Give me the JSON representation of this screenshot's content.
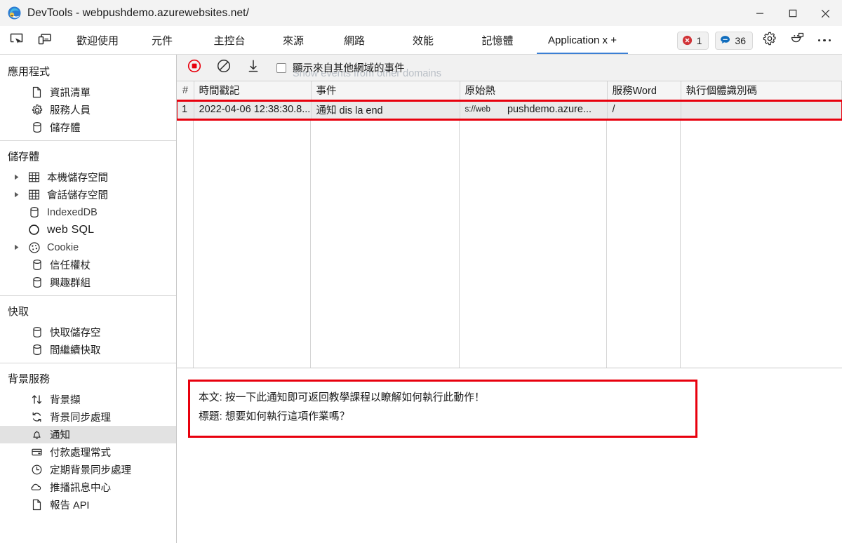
{
  "window": {
    "title": "DevTools - webpushdemo.azurewebsites.net/",
    "logo_icon": "edge-devtools-logo-icon",
    "controls": [
      {
        "name": "minimize-button",
        "icon": "minimize-icon"
      },
      {
        "name": "maximize-button",
        "icon": "maximize-icon"
      },
      {
        "name": "close-button",
        "icon": "close-icon"
      }
    ]
  },
  "tabstrip": {
    "tools": [
      {
        "name": "inspect-element-button",
        "icon": "inspect-cursor-icon"
      },
      {
        "name": "device-emulation-button",
        "icon": "device-toolbar-icon"
      }
    ],
    "tabs": [
      {
        "label": "歡迎使用",
        "active": false
      },
      {
        "label": "元件",
        "active": false
      },
      {
        "label": "主控台",
        "active": false
      },
      {
        "label": "來源",
        "active": false
      },
      {
        "label": "網路",
        "active": false
      },
      {
        "label": "效能",
        "active": false
      },
      {
        "label": "記憶體",
        "active": false
      },
      {
        "label": "Application x +",
        "active": true
      }
    ],
    "badges": [
      {
        "name": "error-count-badge",
        "icon": "error-circle-icon",
        "count": "1",
        "color": "#d13438"
      },
      {
        "name": "message-count-badge",
        "icon": "message-bubble-icon",
        "count": "36",
        "color": "#0f6cbd"
      }
    ],
    "actions": [
      {
        "name": "settings-button",
        "icon": "gear-icon"
      },
      {
        "name": "feedback-button",
        "icon": "feedback-smiley-icon"
      },
      {
        "name": "more-options-button",
        "icon": "ellipsis-icon"
      }
    ]
  },
  "sidebar": {
    "sections": [
      {
        "title": "應用程式",
        "items": [
          {
            "label": "資訊清單",
            "icon": "manifest-file-icon",
            "arrow": false,
            "selected": false
          },
          {
            "label": "服務人員",
            "icon": "gear-icon",
            "arrow": false,
            "selected": false
          },
          {
            "label": "儲存體",
            "icon": "database-icon",
            "arrow": false,
            "selected": false
          }
        ]
      },
      {
        "title": "儲存體",
        "items": [
          {
            "label": "本機儲存空間",
            "icon": "table-grid-icon",
            "arrow": true,
            "selected": false
          },
          {
            "label": "會話儲存空間",
            "icon": "table-grid-icon",
            "arrow": true,
            "selected": false
          },
          {
            "label": "IndexedDB",
            "icon": "database-icon",
            "arrow": false,
            "selected": false,
            "latin": true
          },
          {
            "label": "web SQL",
            "icon": "websql-circle-icon",
            "arrow": false,
            "selected": false,
            "websql": true
          },
          {
            "label": "Cookie",
            "icon": "cookie-icon",
            "arrow": true,
            "selected": false,
            "latin": true
          },
          {
            "label": "信任權杖",
            "icon": "database-icon",
            "arrow": false,
            "selected": false
          },
          {
            "label": "興趣群組",
            "icon": "database-icon",
            "arrow": false,
            "selected": false
          }
        ]
      },
      {
        "title": "快取",
        "items": [
          {
            "label": "快取儲存空",
            "icon": "database-icon",
            "arrow": false,
            "selected": false
          },
          {
            "label": "間繼續快取",
            "icon": "database-icon",
            "arrow": false,
            "selected": false
          }
        ]
      },
      {
        "title": "背景服務",
        "items": [
          {
            "label": "背景擷",
            "icon": "updown-arrows-icon",
            "arrow": false,
            "selected": false
          },
          {
            "label": "背景同步處理",
            "icon": "sync-refresh-icon",
            "arrow": false,
            "selected": false
          },
          {
            "label": "通知",
            "icon": "bell-icon",
            "arrow": false,
            "selected": true
          },
          {
            "label": "付款處理常式",
            "icon": "credit-card-icon",
            "arrow": false,
            "selected": false
          },
          {
            "label": "定期背景同步處理",
            "icon": "clock-icon",
            "arrow": false,
            "selected": false
          },
          {
            "label": "推播訊息中心",
            "icon": "cloud-icon",
            "arrow": false,
            "selected": false
          },
          {
            "label": "報告 API",
            "icon": "report-file-icon",
            "arrow": false,
            "selected": false
          }
        ]
      }
    ]
  },
  "panel": {
    "toolbar": {
      "record_button": {
        "name": "record-button",
        "icon": "record-stop-icon",
        "color": "#e8000d"
      },
      "clear_button": {
        "name": "clear-button",
        "icon": "clear-circle-slash-icon"
      },
      "export_button": {
        "name": "export-button",
        "icon": "download-arrow-icon"
      },
      "checkbox": {
        "name": "show-other-domains-checkbox",
        "checked": false,
        "label": "顯示來自其他網域的事件",
        "ghost_label": "Show events from other domains"
      }
    },
    "table": {
      "columns": [
        "#",
        "時間戳記",
        "事件",
        "原始熱",
        "服務Word",
        "執行個體識別碼"
      ],
      "rows": [
        {
          "num": "1",
          "timestamp": "2022-04-06 12:38:30.8...",
          "event": "通知 dis la end",
          "origin_scheme": "s://web",
          "origin_host": "pushdemo.azure...",
          "service_worker": "/",
          "instance_id": "",
          "highlighted": true
        }
      ]
    },
    "detail": {
      "lines": [
        "本文: 按一下此通知即可返回教學課程以瞭解如何執行此動作！",
        "標題: 想要如何執行這項作業嗎？"
      ],
      "highlight_color": "#e8000d"
    }
  }
}
